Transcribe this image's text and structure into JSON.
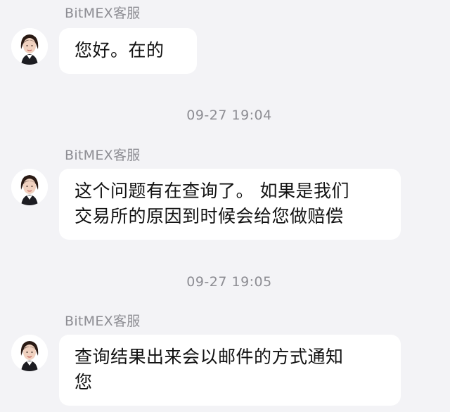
{
  "messages": [
    {
      "sender": "BitMEX客服",
      "avatar_icon": "agent-avatar-icon",
      "lines": [
        "您好。在的"
      ]
    },
    {
      "timestamp": "09-27 19:04",
      "sender": "BitMEX客服",
      "avatar_icon": "agent-avatar-icon",
      "lines": [
        "这个问题有在查询了。 如果是我们",
        "交易所的原因到时候会给您做赔偿"
      ]
    },
    {
      "timestamp": "09-27 19:05",
      "sender": "BitMEX客服",
      "avatar_icon": "agent-avatar-icon",
      "lines": [
        "查询结果出来会以邮件的方式通知",
        "您"
      ]
    }
  ],
  "colors": {
    "background": "#f3f3f6",
    "bubble": "#ffffff",
    "meta_text": "#8d8d93",
    "message_text": "#111111"
  }
}
